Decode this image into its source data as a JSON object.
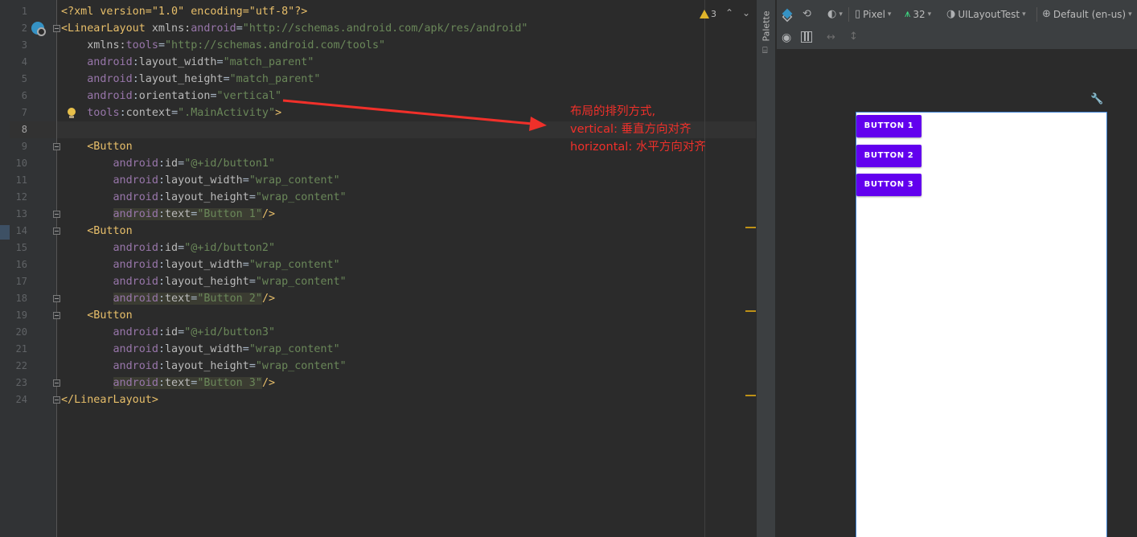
{
  "editor": {
    "line_numbers": [
      "1",
      "2",
      "3",
      "4",
      "5",
      "6",
      "7",
      "8",
      "9",
      "10",
      "11",
      "12",
      "13",
      "14",
      "15",
      "16",
      "17",
      "18",
      "19",
      "20",
      "21",
      "22",
      "23",
      "24"
    ],
    "active_line": "8",
    "warning_count": "3",
    "code": {
      "l1": "<?xml version=\"1.0\" encoding=\"utf-8\"?>",
      "l2_tag": "<LinearLayout",
      "l2_attr": "xmlns:",
      "l2_ns": "android",
      "l2_val": "\"http://schemas.android.com/apk/res/android\"",
      "l3_attr": "xmlns:",
      "l3_ns": "tools",
      "l3_val": "\"http://schemas.android.com/tools\"",
      "l4_attr": "layout_width",
      "l4_val": "\"match_parent\"",
      "l5_attr": "layout_height",
      "l5_val": "\"match_parent\"",
      "l6_attr": "orientation",
      "l6_val": "\"vertical\"",
      "l7_ns": "tools",
      "l7_attr": "context",
      "l7_val": "\".MainActivity\"",
      "button_tag": "<Button",
      "android_ns": "android",
      "id_attr": "id",
      "width_attr": "layout_width",
      "height_attr": "layout_height",
      "text_attr": "text",
      "wrap": "\"wrap_content\"",
      "b1_id": "\"@+id/button1\"",
      "b1_text": "\"Button 1\"",
      "b2_id": "\"@+id/button2\"",
      "b2_text": "\"Button 2\"",
      "b3_id": "\"@+id/button3\"",
      "b3_text": "\"Button 3\"",
      "self_close": "/>",
      "close_gt": ">",
      "close_tag": "</LinearLayout>",
      "eq": "=",
      "colon": ":"
    },
    "annotation": {
      "line1": "布局的排列方式,",
      "line2": "vertical:  垂直方向对齐",
      "line3": "horizontal: 水平方向对齐"
    }
  },
  "palette": {
    "label": "Palette"
  },
  "designer": {
    "toolbar": {
      "device": "Pixel",
      "api": "32",
      "theme": "UILayoutTest",
      "locale": "Default (en-us)"
    },
    "buttons": [
      "BUTTON 1",
      "BUTTON 2",
      "BUTTON 3"
    ]
  },
  "colors": {
    "button": "#6200ee",
    "annotation": "#f0302a",
    "tag": "#e8bf6a",
    "namespace": "#9876aa",
    "value": "#6a8759"
  }
}
